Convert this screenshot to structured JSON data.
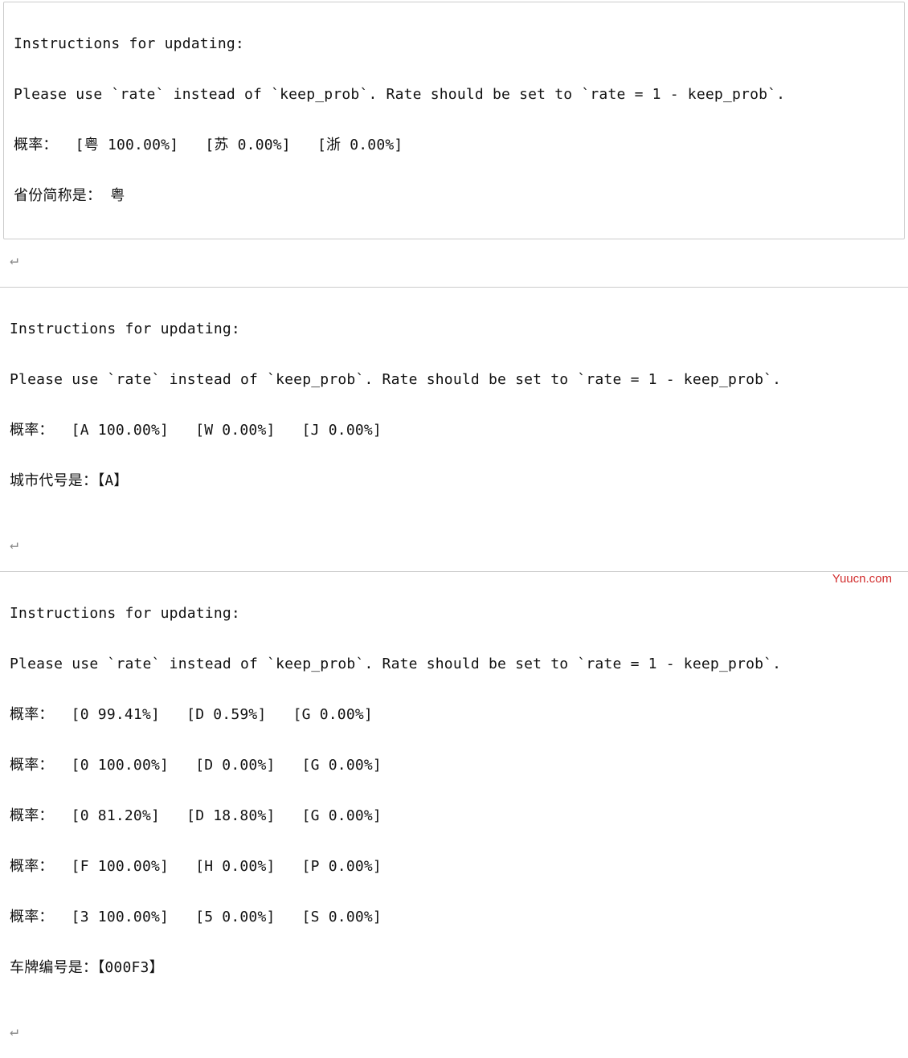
{
  "watermark": "Yuucn.com",
  "ret_glyph": "↵",
  "block1": {
    "l1": "Instructions for updating:",
    "l2": "Please use `rate` instead of `keep_prob`. Rate should be set to `rate = 1 - keep_prob`.",
    "l3": "概率：  [粤 100.00%]   [苏 0.00%]   [浙 0.00%]",
    "l4": "省份简称是： 粤"
  },
  "block2": {
    "l1": "Instructions for updating:",
    "l2": "Please use `rate` instead of `keep_prob`. Rate should be set to `rate = 1 - keep_prob`.",
    "l3": "概率：  [A 100.00%]   [W 0.00%]   [J 0.00%]",
    "l4": "城市代号是：【A】"
  },
  "block3": {
    "l1": "Instructions for updating:",
    "l2": "Please use `rate` instead of `keep_prob`. Rate should be set to `rate = 1 - keep_prob`.",
    "l3": "概率：  [0 99.41%]   [D 0.59%]   [G 0.00%]",
    "l4": "概率：  [0 100.00%]   [D 0.00%]   [G 0.00%]",
    "l5": "概率：  [0 81.20%]   [D 18.80%]   [G 0.00%]",
    "l6": "概率：  [F 100.00%]   [H 0.00%]   [P 0.00%]",
    "l7": "概率：  [3 100.00%]   [5 0.00%]   [S 0.00%]",
    "l8": "车牌编号是：【000F3】"
  }
}
